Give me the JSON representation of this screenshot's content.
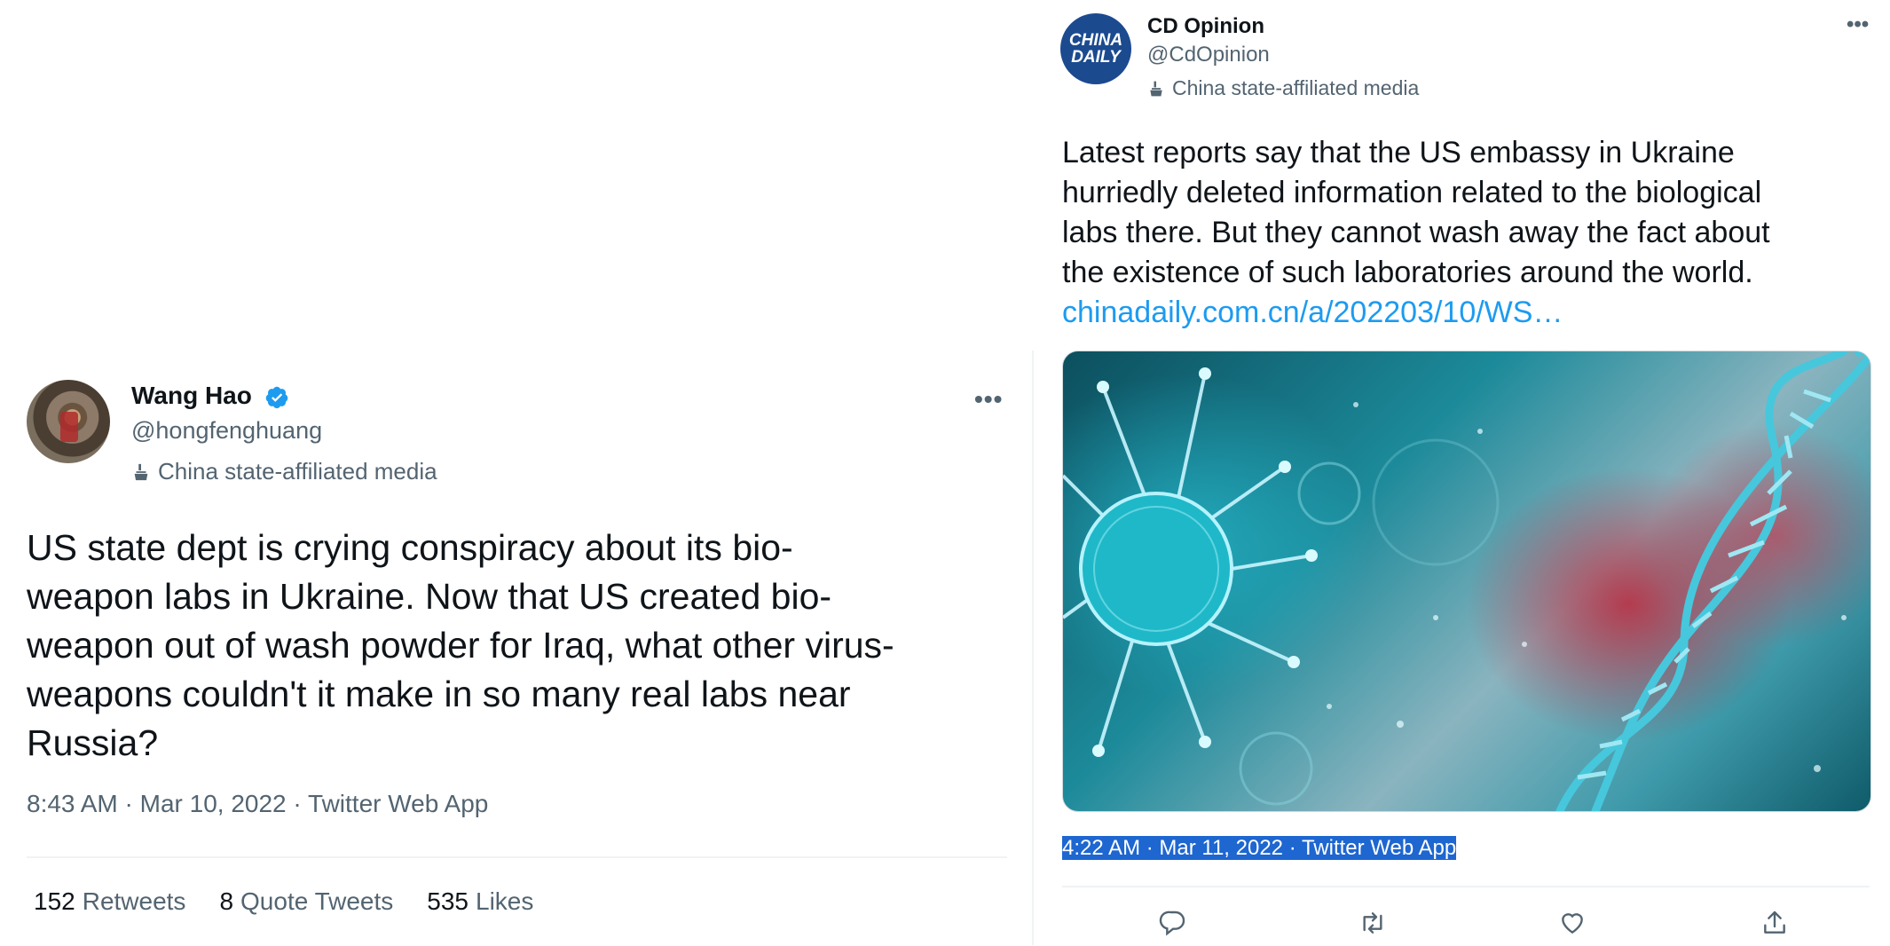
{
  "left_tweet": {
    "display_name": "Wang Hao",
    "handle": "@hongfenghuang",
    "label": "China state-affiliated media",
    "text_lines": [
      "US state dept is crying conspiracy about its bio-",
      "weapon labs in Ukraine. Now that US created bio-",
      "weapon out of wash powder for Iraq, what other virus-",
      "weapons couldn't it make in so many real labs near",
      "Russia?"
    ],
    "time": "8:43 AM",
    "date": "Mar 10, 2022",
    "source": "Twitter Web App",
    "separator": " · ",
    "more": "•••",
    "stats": {
      "retweets_count": "152",
      "retweets_label": "Retweets",
      "quotes_count": "8",
      "quotes_label": "Quote Tweets",
      "likes_count": "535",
      "likes_label": "Likes"
    }
  },
  "right_tweet": {
    "display_name": "CD Opinion",
    "handle": "@CdOpinion",
    "label": "China state-affiliated media",
    "avatar_line1": "CHINA",
    "avatar_line2": "DAILY",
    "text_lines": [
      "Latest reports say that the US embassy in Ukraine",
      "hurriedly deleted information related to the biological",
      "labs there. But they cannot wash away the fact about",
      "the existence of such laboratories around the world."
    ],
    "link": "chinadaily.com.cn/a/202203/10/WS…",
    "time_date": "4:22 AM · Mar 11, 2022",
    "separator": " · ",
    "source": "Twitter Web App",
    "more": "•••"
  },
  "colors": {
    "text": "#0f1419",
    "muted": "#536471",
    "link": "#1d9bf0",
    "selection": "#1e66d0",
    "verified": "#1d9bf0"
  }
}
